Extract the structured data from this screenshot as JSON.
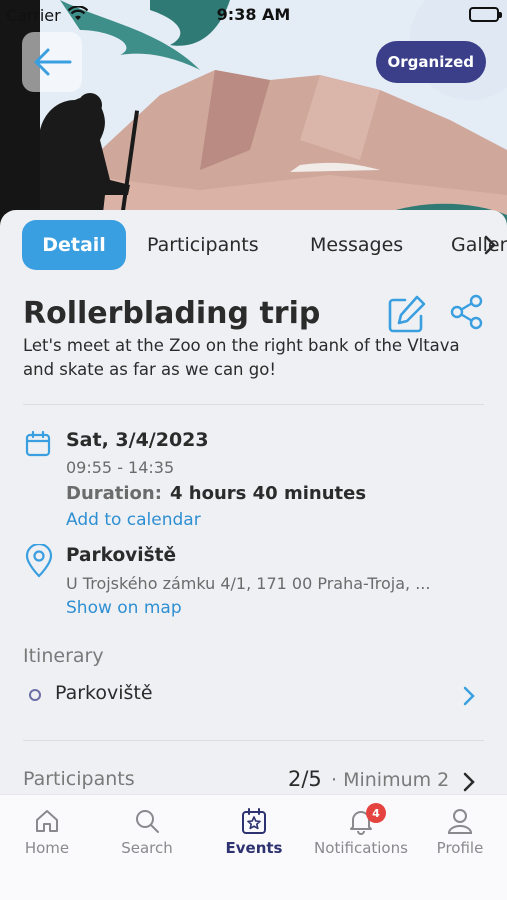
{
  "status_bar": {
    "carrier": "Carrier",
    "time": "9:38 AM"
  },
  "header": {
    "badge": "Organized"
  },
  "tabs": [
    "Detail",
    "Participants",
    "Messages",
    "Gallery"
  ],
  "event": {
    "title": "Rollerblading trip",
    "description": "Let's meet at the Zoo on the right bank of the Vltava and skate as far as we can go!",
    "date": "Sat, 3/4/2023",
    "time_range": "09:55 - 14:35",
    "duration_label": "Duration:",
    "duration_value": "4 hours 40 minutes",
    "add_to_calendar": "Add to calendar",
    "place": "Parkoviště",
    "address": "U Trojského zámku 4/1, 171 00 Praha-Troja, ...",
    "show_on_map": "Show on map"
  },
  "itinerary": {
    "label": "Itinerary",
    "items": [
      "Parkoviště"
    ]
  },
  "participants": {
    "label": "Participants",
    "count": "2/5",
    "minimum": "· Minimum 2"
  },
  "tabbar": {
    "items": [
      {
        "label": "Home",
        "icon": "home-icon"
      },
      {
        "label": "Search",
        "icon": "search-icon"
      },
      {
        "label": "Events",
        "icon": "events-icon",
        "active": true
      },
      {
        "label": "Notifications",
        "icon": "bell-icon",
        "badge": "4"
      },
      {
        "label": "Profile",
        "icon": "profile-icon"
      }
    ]
  },
  "colors": {
    "accent": "#3a9fe0",
    "badge_bg": "#3b3f89",
    "link": "#2f8fd3",
    "active_nav": "#2d3270"
  }
}
